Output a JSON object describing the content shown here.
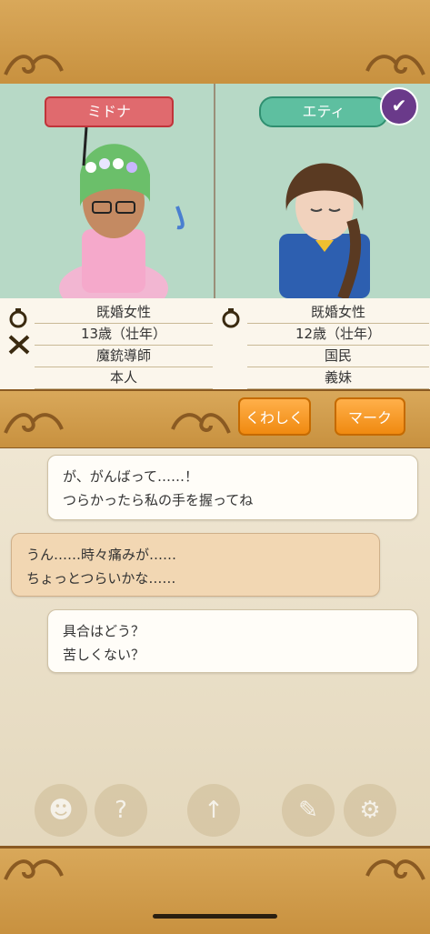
{
  "left_character": {
    "name": "ミドナ",
    "info": [
      "既婚女性",
      "13歳（壮年）",
      "魔銃導師",
      "本人"
    ]
  },
  "right_character": {
    "name": "エティ",
    "info": [
      "既婚女性",
      "12歳（壮年）",
      "国民",
      "義妹"
    ]
  },
  "actions": {
    "detail_label": "くわしく",
    "mark_label": "マーク"
  },
  "chat": [
    {
      "speaker": "right",
      "text": "が、がんばって……！\nつらかったら私の手を握ってね"
    },
    {
      "speaker": "left",
      "text": "うん……時々痛みが……\nちょっとつらいかな……"
    },
    {
      "speaker": "right",
      "text": "具合はどう？\n苦しくない？"
    }
  ],
  "colors": {
    "wood": "#c8913f",
    "panel_bg": "#b7d9c6",
    "name_left": "#e06a6e",
    "name_right": "#5ebfa0",
    "button": "#f08a10"
  },
  "icons": [
    "ring-icon",
    "crossed-guns-icon",
    "check-icon",
    "ornament-icon"
  ]
}
